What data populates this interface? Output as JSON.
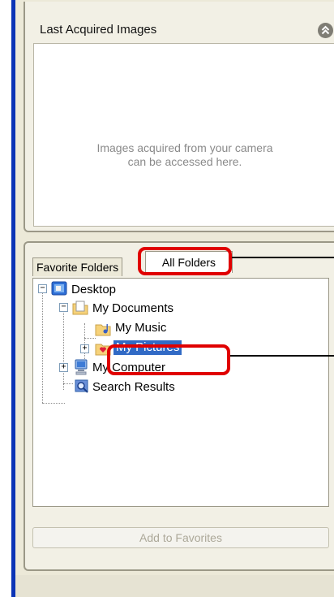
{
  "last_acquired": {
    "title": "Last Acquired Images",
    "message_line1": "Images acquired from your camera",
    "message_line2": "can be accessed here.",
    "collapse_icon": "double-chevron-up-icon"
  },
  "tabs": [
    {
      "label": "Favorite Folders"
    },
    {
      "label": "All Folders",
      "active": true
    }
  ],
  "tree": [
    {
      "label": "Desktop",
      "icon": "desktop-icon"
    },
    {
      "label": "My Documents",
      "icon": "folder-documents-icon"
    },
    {
      "label": "My Music",
      "icon": "folder-music-icon"
    },
    {
      "label": "My Pictures",
      "icon": "folder-pictures-icon",
      "selected": true
    },
    {
      "label": "My Computer",
      "icon": "computer-icon"
    },
    {
      "label": "Search Results",
      "icon": "search-results-icon"
    }
  ],
  "add_button": "Add to Favorites",
  "colors": {
    "highlight_outline": "#e00000",
    "selection": "#316ac5",
    "frame_blue": "#0b34b6",
    "panel_bg": "#ece9d8"
  }
}
